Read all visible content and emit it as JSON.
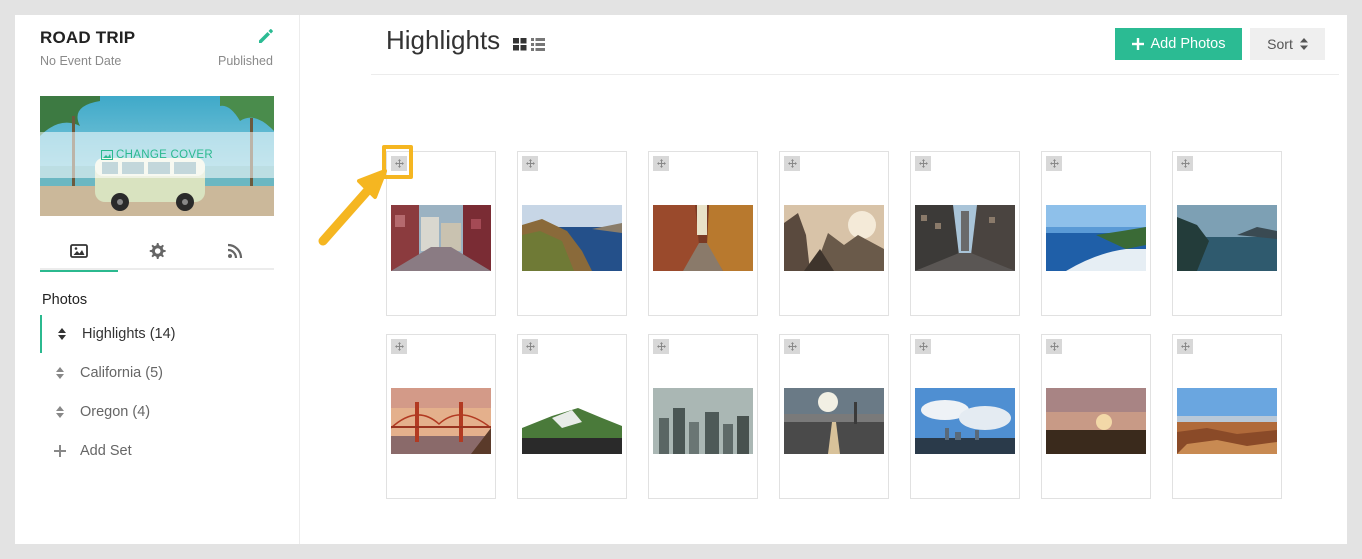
{
  "sidebar": {
    "event_title": "ROAD TRIP",
    "event_date": "No Event Date",
    "status": "Published",
    "change_cover_label": "CHANGE COVER",
    "section_label": "Photos",
    "sets": [
      {
        "label": "Highlights (14)",
        "icon": "reorder-icon",
        "active": true
      },
      {
        "label": "California (5)",
        "icon": "reorder-icon",
        "active": false
      },
      {
        "label": "Oregon (4)",
        "icon": "reorder-icon",
        "active": false
      },
      {
        "label": "Add Set",
        "icon": "plus-icon",
        "active": false
      }
    ],
    "tabs": [
      "photos-tab-icon",
      "settings-gear-icon",
      "rss-feed-icon"
    ]
  },
  "main": {
    "title": "Highlights",
    "add_photos_label": "Add Photos",
    "sort_label": "Sort"
  },
  "colors": {
    "accent": "#2bbb93",
    "highlight": "#f5b621"
  }
}
